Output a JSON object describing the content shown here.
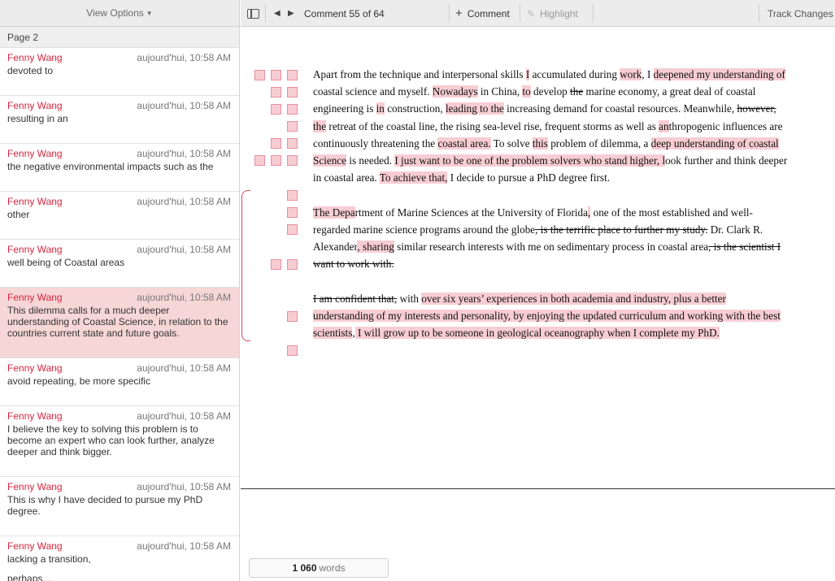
{
  "sidebar": {
    "view_options": "View Options",
    "page_label": "Page 2",
    "comments": [
      {
        "author": "Fenny Wang",
        "time": "aujourd'hui, 10:58 AM",
        "text": "devoted to"
      },
      {
        "author": "Fenny Wang",
        "time": "aujourd'hui, 10:58 AM",
        "text": "resulting in an"
      },
      {
        "author": "Fenny Wang",
        "time": "aujourd'hui, 10:58 AM",
        "text": "the negative environmental impacts such as the"
      },
      {
        "author": "Fenny Wang",
        "time": "aujourd'hui, 10:58 AM",
        "text": "other"
      },
      {
        "author": "Fenny Wang",
        "time": "aujourd'hui, 10:58 AM",
        "text": "well being of Coastal areas"
      },
      {
        "author": "Fenny Wang",
        "time": "aujourd'hui, 10:58 AM",
        "text": "This dilemma calls for a much deeper understanding of Coastal Science, in relation to the countries current state and future goals."
      },
      {
        "author": "Fenny Wang",
        "time": "aujourd'hui, 10:58 AM",
        "text": "avoid repeating, be more specific"
      },
      {
        "author": "Fenny Wang",
        "time": "aujourd'hui, 10:58 AM",
        "text": "I believe the key to solving this problem is to become an expert who can look further, analyze deeper and think bigger."
      },
      {
        "author": "Fenny Wang",
        "time": "aujourd'hui, 10:58 AM",
        "text": "This is why I have decided to pursue my PhD degree."
      },
      {
        "author": "Fenny Wang",
        "time": "aujourd'hui, 10:58 AM",
        "text": "lacking a transition,"
      }
    ],
    "cutoff_text": "perhaps..."
  },
  "toolbar": {
    "comment_counter": "Comment 55 of 64",
    "comment_button": "Comment",
    "highlight_button": "Highlight",
    "track_changes": "Track Changes"
  },
  "document": {
    "p1": {
      "s1": "Apart from the technique and interpersonal skills ",
      "s2": "I",
      "s3": " accumulated during ",
      "s4": "work",
      "s5": ", I ",
      "s6": "deepened my understanding of",
      "s7": " coastal science and myself. ",
      "s8": "Nowadays",
      "s9": " in China, ",
      "s10": "to",
      "s11": " develop ",
      "s12": "the",
      "s13": " marine economy, a great deal of coastal engineering is ",
      "s14": "in",
      "s15": " construction, ",
      "s16": "leading to the",
      "s17": " increasing demand for coastal resources. Meanwhile, ",
      "s18": "however, ",
      "s19": "the",
      "s20": " retreat of the coastal line, the rising sea-level rise, frequent storms as well as ",
      "s21": "an",
      "s22": "thropogenic influences are continuously threatening the ",
      "s23": "coastal area.",
      "s24": " To solve ",
      "s25": "this",
      "s26": " problem of dilemma, a ",
      "s27": "deep understanding of coastal Science",
      "s28": " is needed. ",
      "s29": "I just want to be one of the problem solvers who stand higher, l",
      "s30": "ook further and think deeper in coastal area. ",
      "s31": "To achieve that,",
      "s32": " I decide to pursue a PhD degree first."
    },
    "p2": {
      "s1": "The Depa",
      "s2": "rtment of Marine Sciences at the University of Florida",
      "s3": ",",
      "s4": " one of the most established and well-regarded marine science programs around the globe",
      "s5": ", is the terrific place to further my study.",
      "s6": " Dr. Clark R. Alexander",
      "s7": ", ",
      "s8": "sharing",
      "s9": " similar research interests with me on sedimentary process in coastal area",
      "s10": ", is the scientist I want to work with. "
    },
    "p3": {
      "s1": "I am confident that,",
      "s2": " with ",
      "s3": "over six years’ experiences in both academia and industry, plus a better understanding of my interests and personality, by enjoying the updated curriculum and working with the best scientists",
      "s4": ",",
      "s5": " I will grow up to be someone in geological oceanography when I complete my PhD."
    }
  },
  "wordcount": {
    "count": "1 060",
    "label": "words"
  },
  "colors": {
    "accent_red": "#d7263d",
    "highlight_pink": "#f7cdd3",
    "active_comment_bg": "#f6d6d6"
  }
}
